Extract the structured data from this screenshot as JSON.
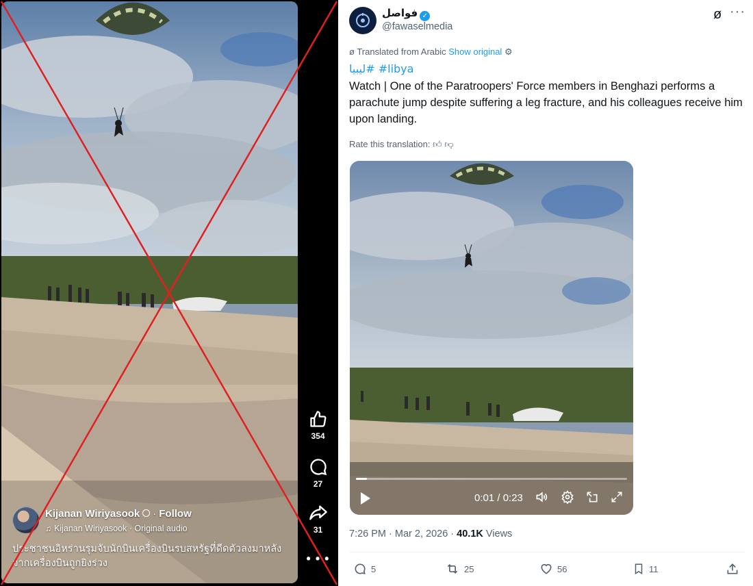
{
  "reel": {
    "author": "Kijanan Wiriyasook",
    "separator": "·",
    "follow": "Follow",
    "audio": "Kijanan Wiriyasook · Original audio",
    "caption": "ประชาชนอิหร่านรุมจับนักบินเครื่องบินรบสหรัฐที่ดีดตัวลงมาหลังจากเครื่องบินถูกยิงร่วง",
    "likes": "354",
    "comments": "27",
    "shares": "31",
    "more": "• • •"
  },
  "tweet": {
    "display_name": "فواصل",
    "handle": "@fawaselmedia",
    "more": "···",
    "translated_label": "Translated from Arabic",
    "show_original": "Show original",
    "hashtags": "ليبيا# #libya",
    "body": "Watch | One of the Paratroopers' Force members in Benghazi performs a parachute jump despite suffering a leg fracture, and his colleagues receive him upon landing.",
    "rate_label": "Rate this translation:",
    "video": {
      "time": "0:01 / 0:23",
      "progress": 0.04
    },
    "time": "7:26 PM · Mar 2, 2026 · ",
    "views_count": "40.1K",
    "views_label": " Views",
    "replies": "5",
    "reposts": "25",
    "likes": "56",
    "bookmarks": "11"
  },
  "colors": {
    "accent": "#1d9bf0",
    "secondary_text": "#536471",
    "strike_red": "#e02020"
  },
  "icons": [
    "thumbs-up-icon",
    "comment-icon",
    "share-icon",
    "globe-icon",
    "music-note-icon",
    "verified-icon",
    "grok-icon",
    "settings-icon",
    "thumbs-down-icon",
    "play-icon",
    "volume-icon",
    "pip-icon",
    "fullscreen-icon",
    "reply-icon",
    "repost-icon",
    "heart-icon",
    "bookmark-icon",
    "upload-icon"
  ]
}
